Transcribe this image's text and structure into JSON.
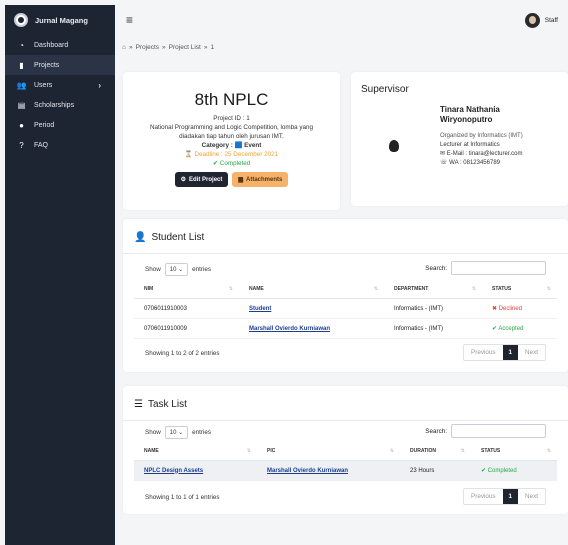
{
  "sidebar": {
    "brand": "Jurnal Magang",
    "items": [
      {
        "label": "Dashboard",
        "icon": "gauge-icon"
      },
      {
        "label": "Projects",
        "icon": "clipboard-icon"
      },
      {
        "label": "Users",
        "icon": "users-icon"
      },
      {
        "label": "Scholarships",
        "icon": "book-icon"
      },
      {
        "label": "Period",
        "icon": "clock-icon"
      },
      {
        "label": "FAQ",
        "icon": "question-icon"
      }
    ],
    "active": "Projects"
  },
  "topbar": {
    "user_name": "Staff"
  },
  "breadcrumb": {
    "items": [
      "Projects",
      "Project List",
      "1"
    ],
    "separator": "»"
  },
  "project": {
    "title": "8th NPLC",
    "project_id": "Project ID : 1",
    "description_line1": "National Programming and Logic Competition, lomba yang",
    "description_line2": "diadakan tiap tahun oleh jurusan IMT.",
    "category": "Category : 🟦 Event",
    "deadline": "⌛ Deadline : 25 December 2021",
    "status": "✔ Completed",
    "edit_label": "Edit Project",
    "attachments_label": "Attachments"
  },
  "supervisor": {
    "title": "Supervisor",
    "name": "Tinara Nathania Wiryonoputro",
    "org": "Organized by Informatics (IMT)",
    "role": "Lecturer at Informatics",
    "email": "✉ E-Mail : tinara@lecturer.com",
    "wa": "☏ WA : 08123456789"
  },
  "students": {
    "title": "Student List",
    "show_label": "Show",
    "entries_label": "entries",
    "page_size": "10 ⌄",
    "search_label": "Search:",
    "columns": [
      "NIM",
      "NAME",
      "DEPARTMENT",
      "STATUS"
    ],
    "rows": [
      {
        "nim": "0706011910003",
        "name": "Student",
        "department": "Informatics - (IMT)",
        "status": "✖ Declined"
      },
      {
        "nim": "0706011910009",
        "name": "Marshall Ovierdo Kurniawan",
        "department": "Informatics - (IMT)",
        "status": "✔ Accepted"
      }
    ],
    "info": "Showing 1 to 2 of 2 entries",
    "prev": "Previous",
    "page": "1",
    "next": "Next"
  },
  "tasks": {
    "title": "Task List",
    "show_label": "Show",
    "entries_label": "entries",
    "page_size": "10 ⌄",
    "search_label": "Search:",
    "columns": [
      "NAME",
      "PIC",
      "DURATION",
      "STATUS"
    ],
    "rows": [
      {
        "name": "NPLC Design Assets",
        "pic": "Marshall Ovierdo Kurniawan",
        "duration": "23 Hours",
        "status": "✔ Completed"
      }
    ],
    "info": "Showing 1 to 1 of 1 entries",
    "prev": "Previous",
    "page": "1",
    "next": "Next"
  },
  "colors": {
    "sidebar": "#1d2432",
    "accent_dark": "#1f2430",
    "deadline": "#e8a33a",
    "success": "#2aa84a",
    "danger": "#e04242",
    "attachments": "#f5b26b"
  }
}
